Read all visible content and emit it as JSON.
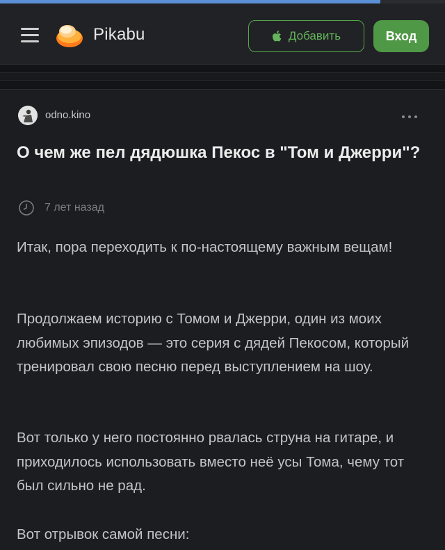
{
  "header": {
    "logo_text": "Pikabu",
    "add_button_label": "Добавить",
    "login_button_label": "Вход",
    "accent_color": "#4f9845"
  },
  "progress": {
    "fraction": 0.855
  },
  "post": {
    "author": "odno.kino",
    "title": "О чем же пел дядюшка Пекос в \"Том и Джерри\"?",
    "time": "7 лет назад",
    "paragraphs": [
      "Итак, пора переходить к по-настоящему важным вещам!",
      "Продолжаем историю с Томом и Джерри, один из моих любимых эпизодов — это серия с дядей Пекосом, который тренировал свою песню перед выступлением на шоу.",
      "Вот только у него постоянно рвалась струна на гитаре, и приходилось использовать вместо неё усы Тома, чему тот был сильно не рад.",
      "Вот отрывок самой песни:"
    ]
  },
  "icons": {
    "menu": "hamburger-menu-icon",
    "logo": "pikabu-logo-icon",
    "apple": "apple-icon",
    "more": "more-dots-icon",
    "clock": "clock-icon"
  }
}
